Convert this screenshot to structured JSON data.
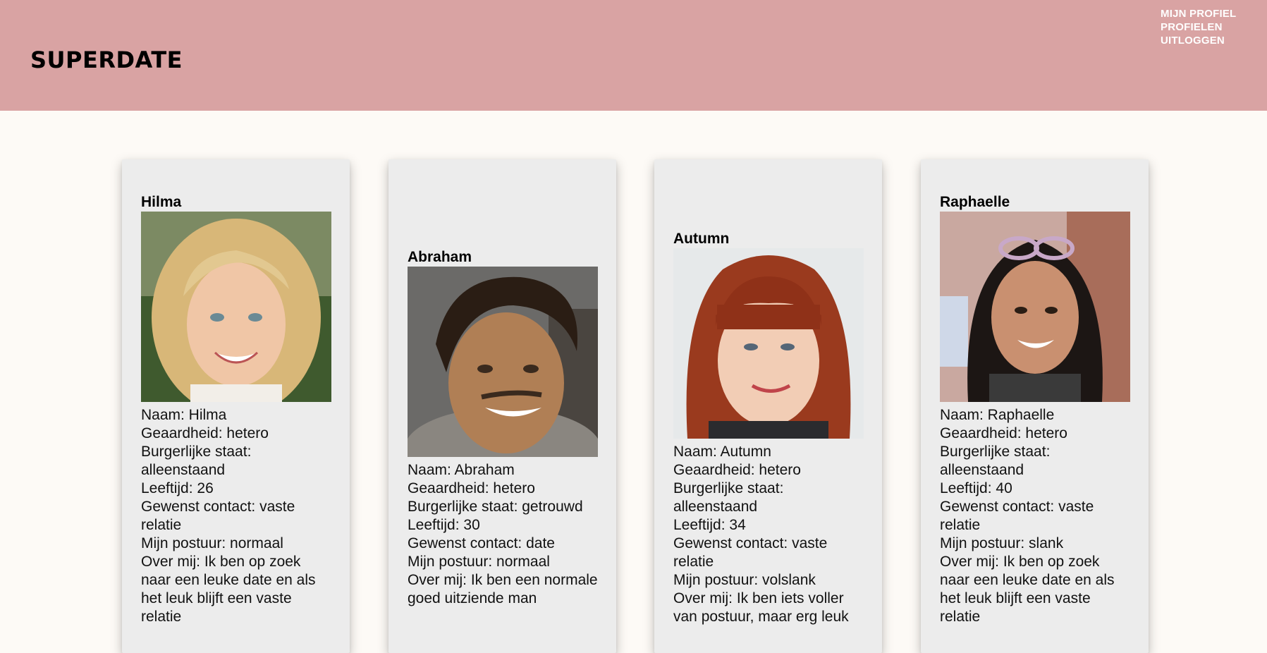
{
  "header": {
    "brand": "SUPERDATE",
    "nav": [
      "MIJN PROFIEL",
      "PROFIELEN",
      "UITLOGGEN"
    ]
  },
  "colors": {
    "header_bg": "#d9a3a3",
    "page_bg": "#fdfaf6",
    "card_bg": "#ececec"
  },
  "profiles": [
    {
      "name": "Hilma",
      "photo_icon": "profile-photo-blonde-woman",
      "naam": "Naam: Hilma",
      "geaardheid": "Geaardheid: hetero",
      "burgerlijke_staat": "Burgerlijke staat: alleenstaand",
      "leeftijd": "Leeftijd: 26",
      "gewenst_contact": "Gewenst contact: vaste relatie",
      "postuur": "Mijn postuur: normaal",
      "over_mij": "Over mij: Ik ben op zoek naar een leuke date en als het leuk blijft een vaste relatie"
    },
    {
      "name": "Abraham",
      "photo_icon": "profile-photo-dark-haired-man",
      "naam": "Naam: Abraham",
      "geaardheid": "Geaardheid: hetero",
      "burgerlijke_staat": "Burgerlijke staat: getrouwd",
      "leeftijd": "Leeftijd: 30",
      "gewenst_contact": "Gewenst contact: date",
      "postuur": "Mijn postuur: normaal",
      "over_mij": "Over mij: Ik ben een normale goed uitziende man"
    },
    {
      "name": "Autumn",
      "photo_icon": "profile-photo-red-haired-woman",
      "naam": "Naam: Autumn",
      "geaardheid": "Geaardheid: hetero",
      "burgerlijke_staat": "Burgerlijke staat: alleenstaand",
      "leeftijd": "Leeftijd: 34",
      "gewenst_contact": "Gewenst contact: vaste relatie",
      "postuur": "Mijn postuur: volslank",
      "over_mij": "Over mij: Ik ben iets voller van postuur, maar erg leuk"
    },
    {
      "name": "Raphaelle",
      "photo_icon": "profile-photo-dark-haired-woman",
      "naam": "Naam: Raphaelle",
      "geaardheid": "Geaardheid: hetero",
      "burgerlijke_staat": "Burgerlijke staat: alleenstaand",
      "leeftijd": "Leeftijd: 40",
      "gewenst_contact": "Gewenst contact: vaste relatie",
      "postuur": "Mijn postuur: slank",
      "over_mij": "Over mij: Ik ben op zoek naar een leuke date en als het leuk blijft een vaste relatie"
    }
  ]
}
